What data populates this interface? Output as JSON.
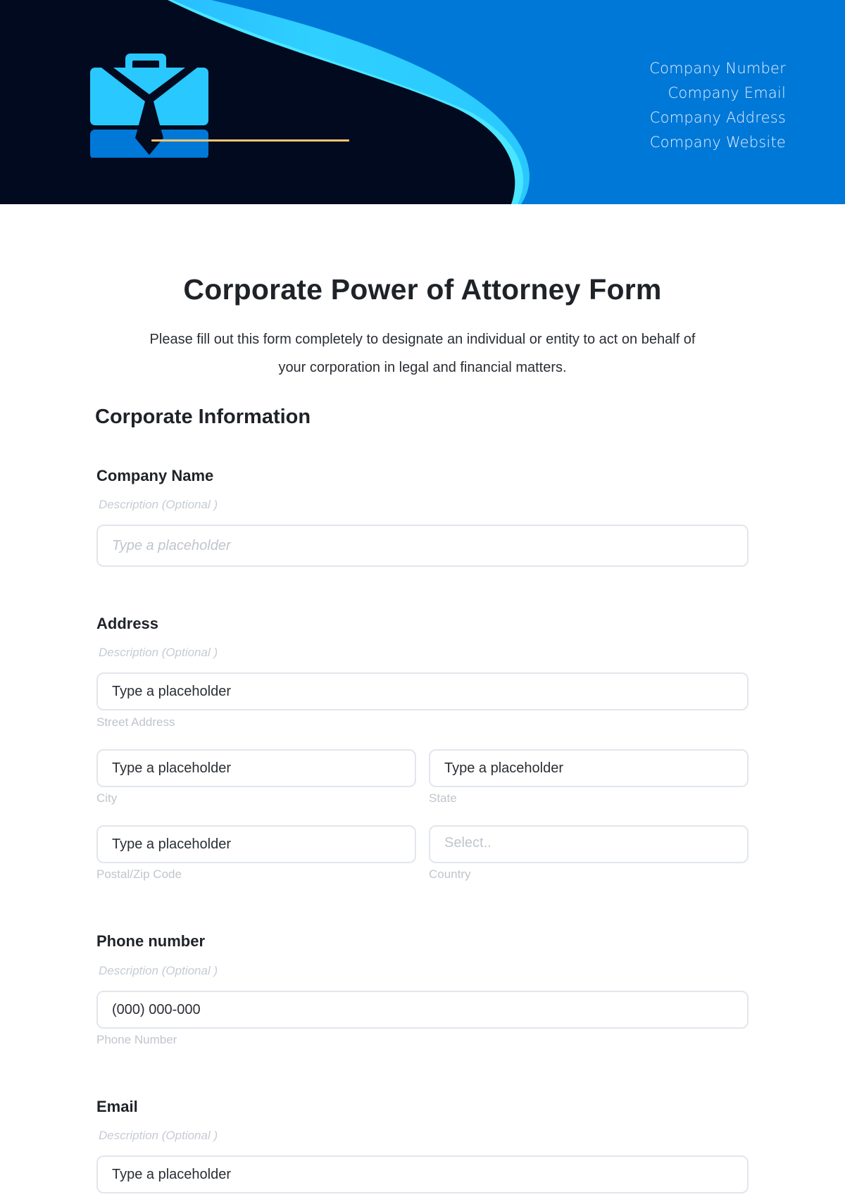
{
  "header": {
    "logo_icon": "briefcase-tie-icon",
    "contact_lines": [
      "Company Number",
      "Company Email",
      "Company Address",
      "Company Website"
    ],
    "colors": {
      "dark": "#020a1f",
      "blue": "#0078d7",
      "cyan": "#29c8ff",
      "aqua": "#4ae6ff",
      "gold": "#f2c66d"
    }
  },
  "form": {
    "title": "Corporate Power of Attorney Form",
    "intro_line1": "Please fill out this form completely to designate an individual or entity to act on behalf of",
    "intro_line2": "your corporation in legal and financial matters.",
    "section_title": "Corporate Information",
    "fields": {
      "company_name": {
        "label": "Company Name",
        "description": "Description  (Optional )",
        "placeholder": "Type a placeholder"
      },
      "address": {
        "label": "Address",
        "description": "Description  (Optional )",
        "street": {
          "value": "Type a placeholder",
          "sublabel": "Street Address"
        },
        "city": {
          "value": "Type a placeholder",
          "sublabel": "City"
        },
        "state": {
          "value": "Type a placeholder",
          "sublabel": "State"
        },
        "postal": {
          "value": "Type a placeholder",
          "sublabel": "Postal/Zip Code"
        },
        "country": {
          "placeholder": "Select..",
          "sublabel": "Country"
        }
      },
      "phone": {
        "label": "Phone number",
        "description": "Description  (Optional )",
        "value": "(000) 000-000",
        "sublabel": "Phone Number"
      },
      "email": {
        "label": "Email",
        "description": "Description  (Optional )",
        "value": "Type a placeholder"
      }
    }
  }
}
